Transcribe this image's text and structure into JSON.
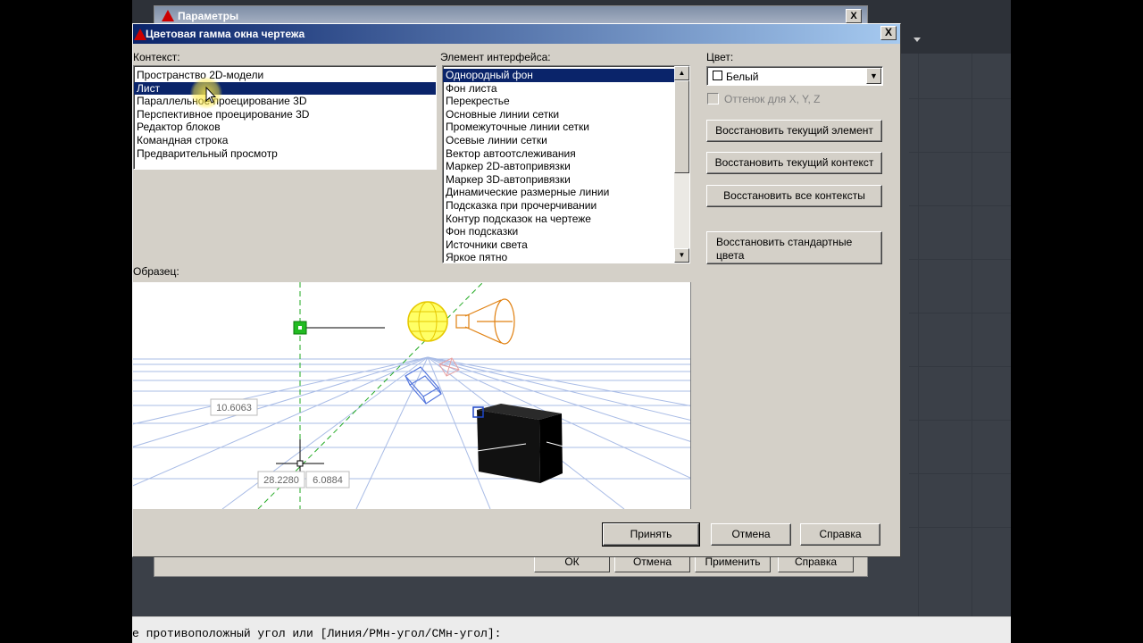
{
  "command_line": {
    "text": "е противоположный угол или [Линия/РМн-угол/СМн-угол]:"
  },
  "params_window": {
    "title": "Параметры",
    "close_label": "X",
    "buttons": [
      "ОК",
      "Отмена",
      "Применить",
      "Справка"
    ]
  },
  "dialog": {
    "title": "Цветовая гамма окна чертежа",
    "close_label": "X"
  },
  "context": {
    "label": "Контекст:",
    "items": [
      "Пространство 2D-модели",
      "Лист",
      "Параллельное проецирование 3D",
      "Перспективное проецирование 3D",
      "Редактор блоков",
      "Командная строка",
      "Предварительный просмотр"
    ],
    "selected_index": 1
  },
  "interface_element": {
    "label": "Элемент интерфейса:",
    "items": [
      "Однородный фон",
      "Фон листа",
      "Перекрестье",
      "Основные линии сетки",
      "Промежуточные линии сетки",
      "Осевые линии сетки",
      "Вектор автоотслеживания",
      "Маркер 2D-автопривязки",
      "Маркер 3D-автопривязки",
      "Динамические размерные линии",
      "Подсказка при прочерчивании",
      "Контур подсказок на чертеже",
      "Фон подсказки",
      "Источники света",
      "Яркое пятно"
    ],
    "selected_index": 0
  },
  "color": {
    "label": "Цвет:",
    "value": "Белый",
    "tint_label": "Оттенок для X, Y, Z"
  },
  "actions": {
    "restore_element": "Восстановить текущий элемент",
    "restore_context": "Восстановить текущий контекст",
    "restore_all": "Восстановить все контексты",
    "restore_classic": "Восстановить стандартные цвета"
  },
  "preview": {
    "label": "Образец:",
    "dim_1": "10.6063",
    "dim_2": "28.2280",
    "dim_3": "6.0884"
  },
  "footer": {
    "accept": "Принять",
    "cancel": "Отмена",
    "help": "Справка"
  }
}
